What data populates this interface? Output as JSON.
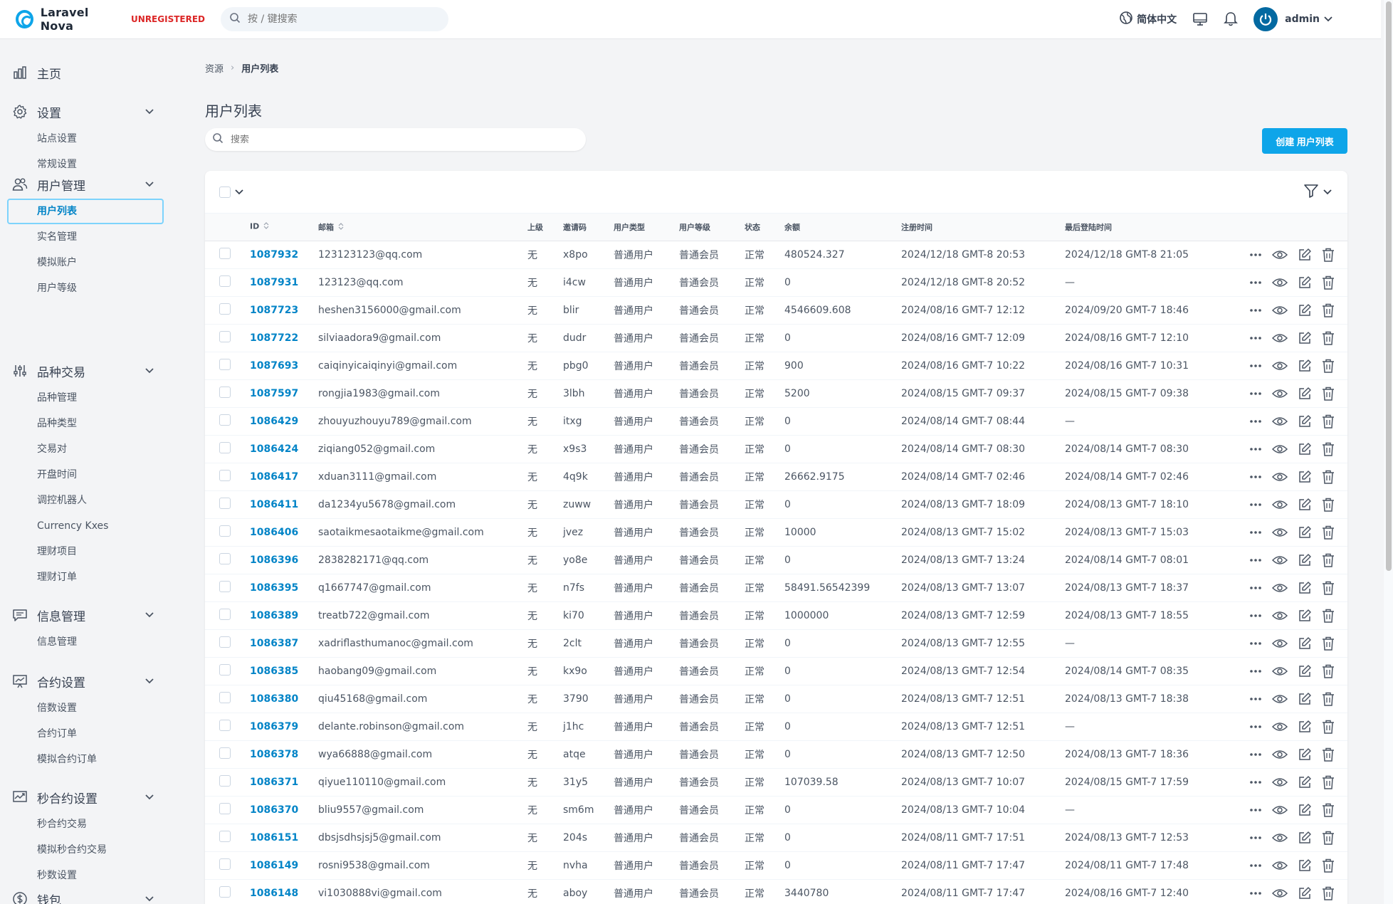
{
  "brand": {
    "name": "Laravel Nova",
    "tag": "UNREGISTERED"
  },
  "header": {
    "search_placeholder": "按 / 键搜索",
    "language": "简体中文",
    "user": "admin"
  },
  "sidebar": {
    "groups": [
      {
        "label": "主页",
        "icon": "chart-bar-icon",
        "items": []
      },
      {
        "label": "设置",
        "icon": "gear-icon",
        "items": [
          "站点设置",
          "常规设置"
        ]
      },
      {
        "label": "用户管理",
        "icon": "users-icon",
        "items": [
          "用户列表",
          "实名管理",
          "模拟账户",
          "用户等级"
        ]
      },
      {
        "label": "品种交易",
        "icon": "sliders-icon",
        "items": [
          "品种管理",
          "品种类型",
          "交易对",
          "开盘时间",
          "调控机器人",
          "Currency Kxes",
          "理财项目",
          "理财订单"
        ]
      },
      {
        "label": "信息管理",
        "icon": "chat-icon",
        "items": [
          "信息管理"
        ]
      },
      {
        "label": "合约设置",
        "icon": "presentation-chart-icon",
        "items": [
          "倍数设置",
          "合约订单",
          "模拟合约订单"
        ]
      },
      {
        "label": "秒合约设置",
        "icon": "trend-chart-icon",
        "items": [
          "秒合约交易",
          "模拟秒合约交易",
          "秒数设置"
        ]
      },
      {
        "label": "钱包",
        "icon": "currency-dollar-icon",
        "items": []
      }
    ]
  },
  "breadcrumb": {
    "root": "资源",
    "current": "用户列表"
  },
  "page": {
    "title": "用户列表",
    "search_placeholder": "搜索",
    "create_label": "创建 用户列表"
  },
  "table": {
    "columns": {
      "id": "ID",
      "email": "邮箱",
      "parent": "上级",
      "invite": "邀请码",
      "type": "用户类型",
      "level": "用户等级",
      "status": "状态",
      "balance": "余额",
      "registered": "注册时间",
      "last_login": "最后登陆时间"
    },
    "rows": [
      [
        "1087932",
        "123123123@qq.com",
        "无",
        "x8po",
        "普通用户",
        "普通会员",
        "正常",
        "480524.327",
        "2024/12/18 GMT-8 20:53",
        "2024/12/18 GMT-8 21:05"
      ],
      [
        "1087931",
        "123123@qq.com",
        "无",
        "i4cw",
        "普通用户",
        "普通会员",
        "正常",
        "0",
        "2024/12/18 GMT-8 20:52",
        "—"
      ],
      [
        "1087723",
        "heshen3156000@gmail.com",
        "无",
        "blir",
        "普通用户",
        "普通会员",
        "正常",
        "4546609.608",
        "2024/08/16 GMT-7 12:12",
        "2024/09/20 GMT-7 18:46"
      ],
      [
        "1087722",
        "silviaadora9@gmail.com",
        "无",
        "dudr",
        "普通用户",
        "普通会员",
        "正常",
        "0",
        "2024/08/16 GMT-7 12:09",
        "2024/08/16 GMT-7 12:10"
      ],
      [
        "1087693",
        "caiqinyicaiqinyi@gmail.com",
        "无",
        "pbg0",
        "普通用户",
        "普通会员",
        "正常",
        "900",
        "2024/08/16 GMT-7 10:22",
        "2024/08/16 GMT-7 10:31"
      ],
      [
        "1087597",
        "rongjia1983@gmail.com",
        "无",
        "3lbh",
        "普通用户",
        "普通会员",
        "正常",
        "5200",
        "2024/08/15 GMT-7 09:37",
        "2024/08/15 GMT-7 09:38"
      ],
      [
        "1086429",
        "zhouyuzhouyu789@gmail.com",
        "无",
        "itxg",
        "普通用户",
        "普通会员",
        "正常",
        "0",
        "2024/08/14 GMT-7 08:44",
        "—"
      ],
      [
        "1086424",
        "ziqiang052@gmail.com",
        "无",
        "x9s3",
        "普通用户",
        "普通会员",
        "正常",
        "0",
        "2024/08/14 GMT-7 08:30",
        "2024/08/14 GMT-7 08:30"
      ],
      [
        "1086417",
        "xduan3111@gmail.com",
        "无",
        "4q9k",
        "普通用户",
        "普通会员",
        "正常",
        "26662.9175",
        "2024/08/14 GMT-7 02:46",
        "2024/08/14 GMT-7 02:46"
      ],
      [
        "1086411",
        "da1234yu5678@gmail.com",
        "无",
        "zuww",
        "普通用户",
        "普通会员",
        "正常",
        "0",
        "2024/08/13 GMT-7 18:09",
        "2024/08/13 GMT-7 18:10"
      ],
      [
        "1086406",
        "saotaikmesaotaikme@gmail.com",
        "无",
        "jvez",
        "普通用户",
        "普通会员",
        "正常",
        "10000",
        "2024/08/13 GMT-7 15:02",
        "2024/08/13 GMT-7 15:03"
      ],
      [
        "1086396",
        "2838282171@qq.com",
        "无",
        "yo8e",
        "普通用户",
        "普通会员",
        "正常",
        "0",
        "2024/08/13 GMT-7 13:24",
        "2024/08/14 GMT-7 08:01"
      ],
      [
        "1086395",
        "q1667747@gmail.com",
        "无",
        "n7fs",
        "普通用户",
        "普通会员",
        "正常",
        "58491.56542399",
        "2024/08/13 GMT-7 13:07",
        "2024/08/13 GMT-7 18:37"
      ],
      [
        "1086389",
        "treatb722@gmail.com",
        "无",
        "ki70",
        "普通用户",
        "普通会员",
        "正常",
        "1000000",
        "2024/08/13 GMT-7 12:59",
        "2024/08/13 GMT-7 18:55"
      ],
      [
        "1086387",
        "xadriflasthumanoc@gmail.com",
        "无",
        "2clt",
        "普通用户",
        "普通会员",
        "正常",
        "0",
        "2024/08/13 GMT-7 12:55",
        "—"
      ],
      [
        "1086385",
        "haobang09@gmail.com",
        "无",
        "kx9o",
        "普通用户",
        "普通会员",
        "正常",
        "0",
        "2024/08/13 GMT-7 12:54",
        "2024/08/14 GMT-7 08:35"
      ],
      [
        "1086380",
        "qiu45168@gmail.com",
        "无",
        "3790",
        "普通用户",
        "普通会员",
        "正常",
        "0",
        "2024/08/13 GMT-7 12:51",
        "2024/08/13 GMT-7 18:38"
      ],
      [
        "1086379",
        "delante.robinson@gmail.com",
        "无",
        "j1hc",
        "普通用户",
        "普通会员",
        "正常",
        "0",
        "2024/08/13 GMT-7 12:51",
        "—"
      ],
      [
        "1086378",
        "wya66888@gmail.com",
        "无",
        "atqe",
        "普通用户",
        "普通会员",
        "正常",
        "0",
        "2024/08/13 GMT-7 12:50",
        "2024/08/13 GMT-7 18:36"
      ],
      [
        "1086371",
        "qiyue110110@gmail.com",
        "无",
        "31y5",
        "普通用户",
        "普通会员",
        "正常",
        "107039.58",
        "2024/08/13 GMT-7 10:07",
        "2024/08/15 GMT-7 17:59"
      ],
      [
        "1086370",
        "bliu9557@gmail.com",
        "无",
        "sm6m",
        "普通用户",
        "普通会员",
        "正常",
        "0",
        "2024/08/13 GMT-7 10:04",
        "—"
      ],
      [
        "1086151",
        "dbsjsdhsjsj5@gmail.com",
        "无",
        "204s",
        "普通用户",
        "普通会员",
        "正常",
        "0",
        "2024/08/11 GMT-7 17:51",
        "2024/08/13 GMT-7 12:53"
      ],
      [
        "1086149",
        "rosni9538@gmail.com",
        "无",
        "nvha",
        "普通用户",
        "普通会员",
        "正常",
        "0",
        "2024/08/11 GMT-7 17:47",
        "2024/08/11 GMT-7 17:48"
      ],
      [
        "1086148",
        "vi1030888vi@gmail.com",
        "无",
        "aboy",
        "普通用户",
        "普通会员",
        "正常",
        "3440780",
        "2024/08/11 GMT-7 17:47",
        "2024/08/16 GMT-7 12:40"
      ]
    ]
  },
  "colors": {
    "accent": "#0ea5e9",
    "link": "#0284c7",
    "unregistered": "#dc2626"
  }
}
